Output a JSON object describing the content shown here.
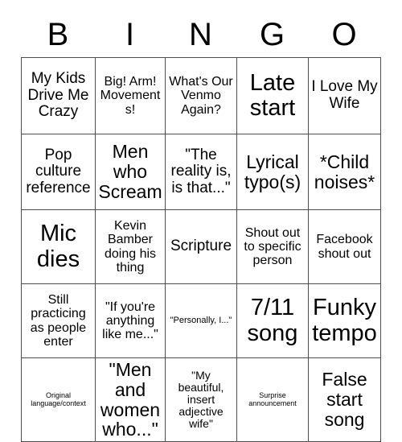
{
  "card": {
    "title": "BINGO",
    "header_letters": [
      "B",
      "I",
      "N",
      "G",
      "O"
    ],
    "columns": 5,
    "rows": 5,
    "border_color": "#4d4d4d",
    "text_color": "#000000",
    "background_color": "#ffffff",
    "cells": [
      [
        {
          "text": "My Kids Drive Me Crazy",
          "size": "lg",
          "marked": false
        },
        {
          "text": "Big! Arm! Movements!",
          "size": "md",
          "marked": false
        },
        {
          "text": "What's Our Venmo Again?",
          "size": "md",
          "marked": false
        },
        {
          "text": "Late start",
          "size": "xxl",
          "marked": false
        },
        {
          "text": "I Love My Wife",
          "size": "lg",
          "marked": false
        }
      ],
      [
        {
          "text": "Pop culture reference",
          "size": "lg",
          "marked": false
        },
        {
          "text": "Men who Scream",
          "size": "xl",
          "marked": false
        },
        {
          "text": "\"The reality is, is that...\"",
          "size": "lg",
          "marked": false
        },
        {
          "text": "Lyrical typo(s)",
          "size": "xl",
          "marked": false
        },
        {
          "text": "*Child noises*",
          "size": "xl",
          "marked": false
        }
      ],
      [
        {
          "text": "Mic dies",
          "size": "xxl",
          "marked": false
        },
        {
          "text": "Kevin Bamber doing his thing",
          "size": "md",
          "marked": false
        },
        {
          "text": "Scripture",
          "size": "lg",
          "marked": false
        },
        {
          "text": "Shout out to specific person",
          "size": "md",
          "marked": false
        },
        {
          "text": "Facebook shout out",
          "size": "md",
          "marked": false
        }
      ],
      [
        {
          "text": "Still practicing as people enter",
          "size": "md",
          "marked": false
        },
        {
          "text": "\"If you're anything like me...\"",
          "size": "md",
          "marked": false
        },
        {
          "text": "\"Personally, I...\"",
          "size": "xs",
          "marked": false
        },
        {
          "text": "7/11 song",
          "size": "xxl",
          "marked": false
        },
        {
          "text": "Funky tempo",
          "size": "xxl",
          "marked": false
        }
      ],
      [
        {
          "text": "Original language/context",
          "size": "xxs",
          "marked": false
        },
        {
          "text": "\"Men and women who...\"",
          "size": "xl",
          "marked": false
        },
        {
          "text": "\"My beautiful, insert adjective wife\"",
          "size": "sm",
          "marked": false
        },
        {
          "text": "Surprise announcement",
          "size": "xxs",
          "marked": false
        },
        {
          "text": "False start song",
          "size": "xl",
          "marked": false
        }
      ]
    ]
  }
}
